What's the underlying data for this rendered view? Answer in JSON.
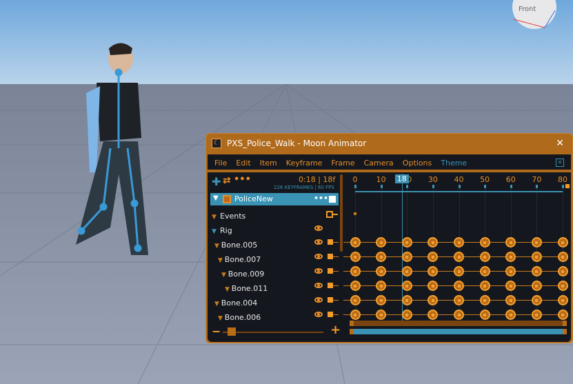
{
  "scene": {
    "gizmo_label": "Front"
  },
  "window": {
    "title": "PXS_Police_Walk - Moon Animator",
    "close": "✕"
  },
  "menu": [
    "File",
    "Edit",
    "Item",
    "Keyframe",
    "Frame",
    "Camera",
    "Options",
    "Theme"
  ],
  "toolbar": {
    "time": "0:18",
    "frame": "18f",
    "info": "226 KEYFRAMES | 60 FPS"
  },
  "timeline": {
    "ticks": [
      0,
      10,
      20,
      30,
      40,
      50,
      60,
      70,
      80
    ],
    "playhead": 18,
    "playhead_label": "18",
    "max": 80,
    "keyframes": [
      0,
      10,
      20,
      30,
      40,
      50,
      60,
      70,
      80
    ]
  },
  "tracks": {
    "root": "PoliceNew",
    "events": "Events",
    "rig": "Rig",
    "bones": [
      "Bone.005",
      "Bone.007",
      "Bone.009",
      "Bone.011",
      "Bone.004",
      "Bone.006"
    ]
  },
  "zoom": {
    "minus": "−",
    "plus": "+",
    "value": 0.05
  },
  "colors": {
    "accent": "#e88f2a",
    "blue": "#3a93b4",
    "bg": "#14171d"
  }
}
